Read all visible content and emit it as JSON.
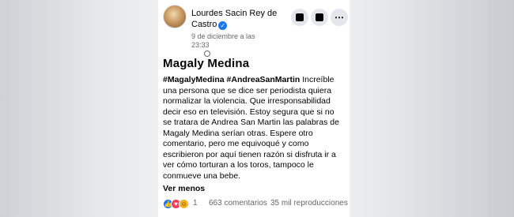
{
  "post": {
    "author": "Lourdes Sacin Rey de Castro",
    "date": "9 de diciembre a las 23:33",
    "title": "Magaly Medina",
    "hashtags": "#MagalyMedina #AndreaSanMartin",
    "body": "Increíble una persona que se dice ser periodista quiera normalizar la violencia. Que irresponsabilidad decir eso en televisión. Estoy segura que si no se tratara de Andrea San Martin las palabras de Magaly Medina serían otras. Espere otro comentario, pero me equivoqué y como escribieron por aquí tienen razón si disfruta ir a ver cómo torturan a los toros, tampoco le conmueve una bebe.",
    "see_less": "Ver menos",
    "reaction_count": "1",
    "comments": "663 comentarios",
    "views": "35 mil reproducciones"
  },
  "icons": {
    "verified": "verified-badge-icon",
    "privacy": "globe-icon",
    "reactions": [
      "like-icon",
      "love-icon",
      "haha-icon"
    ]
  },
  "colors": {
    "accent": "#1877f2",
    "love": "#f33e58",
    "haha": "#f7b125",
    "text": "#050505",
    "muted": "#65676b"
  }
}
